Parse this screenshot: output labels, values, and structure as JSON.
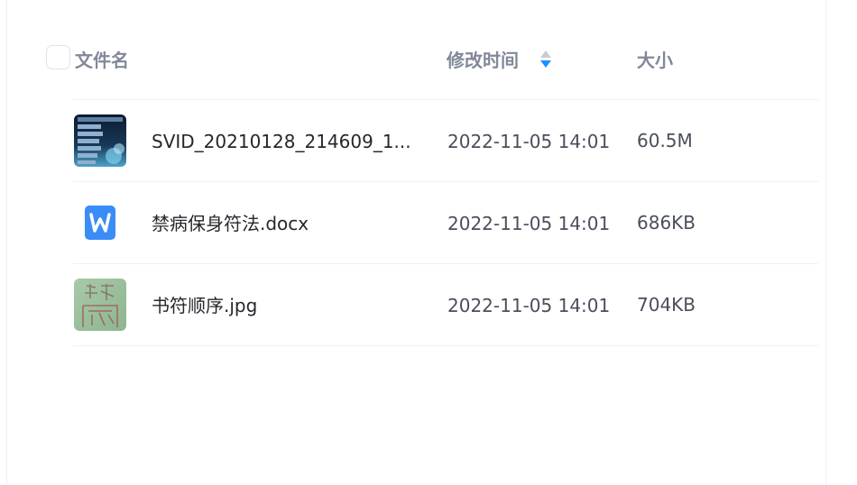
{
  "header": {
    "name_label": "文件名",
    "time_label": "修改时间",
    "size_label": "大小",
    "sort_icon": "sort-caret-icon"
  },
  "files": [
    {
      "name": "SVID_20210128_214609_1...",
      "modified": "2022-11-05 14:01",
      "size": "60.5M",
      "icon": "video-thumbnail"
    },
    {
      "name": "禁病保身符法.docx",
      "modified": "2022-11-05 14:01",
      "size": "686KB",
      "icon": "word-doc-icon"
    },
    {
      "name": "书符顺序.jpg",
      "modified": "2022-11-05 14:01",
      "size": "704KB",
      "icon": "image-thumbnail"
    }
  ],
  "colors": {
    "header_text": "#818898",
    "file_name": "#25272d",
    "meta_text": "#4a4f5b",
    "sort_active": "#1e90ff",
    "sort_inactive": "#c8ccd3",
    "word_blue": "#3a8cf7"
  }
}
